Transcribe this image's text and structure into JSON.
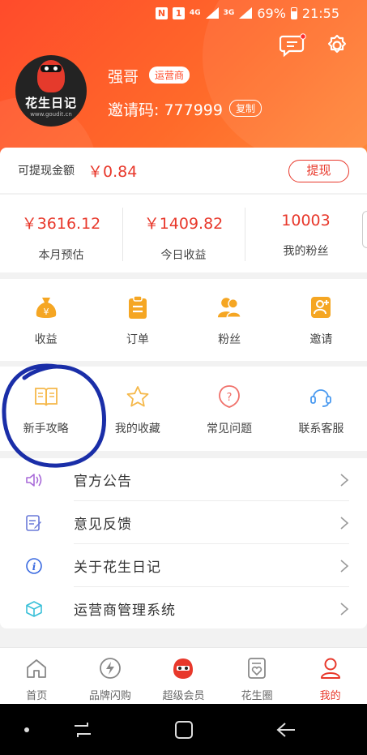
{
  "status_bar": {
    "net_4g": "4G",
    "net_3g": "3G",
    "battery": "69%",
    "time": "21:55"
  },
  "header": {
    "avatar_text": "花生日记",
    "avatar_url": "www.goudit.cn",
    "username": "强哥",
    "role_badge": "运营商",
    "invite_label": "邀请码: 777999",
    "copy_label": "复制"
  },
  "withdraw": {
    "label": "可提现金额",
    "amount": "￥0.84",
    "button": "提现"
  },
  "stats": [
    {
      "value": "￥3616.12",
      "label": "本月预估"
    },
    {
      "value": "￥1409.82",
      "label": "今日收益"
    },
    {
      "value": "10003",
      "label": "我的粉丝"
    }
  ],
  "quick_grid": [
    {
      "label": "收益",
      "icon": "money-bag-icon"
    },
    {
      "label": "订单",
      "icon": "clipboard-icon"
    },
    {
      "label": "粉丝",
      "icon": "people-icon"
    },
    {
      "label": "邀请",
      "icon": "invite-icon"
    }
  ],
  "tools_grid": [
    {
      "label": "新手攻略",
      "icon": "book-icon"
    },
    {
      "label": "我的收藏",
      "icon": "star-icon"
    },
    {
      "label": "常见问题",
      "icon": "question-icon"
    },
    {
      "label": "联系客服",
      "icon": "headset-icon"
    }
  ],
  "menu": [
    {
      "label": "官方公告",
      "icon": "speaker-icon"
    },
    {
      "label": "意见反馈",
      "icon": "feedback-icon"
    },
    {
      "label": "关于花生日记",
      "icon": "info-icon"
    },
    {
      "label": "运营商管理系统",
      "icon": "cube-icon"
    }
  ],
  "tabbar": [
    {
      "label": "首页",
      "icon": "home-icon"
    },
    {
      "label": "品牌闪购",
      "icon": "flash-icon"
    },
    {
      "label": "超级会员",
      "icon": "mascot-icon"
    },
    {
      "label": "花生圈",
      "icon": "heart-card-icon"
    },
    {
      "label": "我的",
      "icon": "user-icon",
      "active": true
    }
  ],
  "colors": {
    "brand_red": "#e8382b",
    "header_orange": "#ff5a2a",
    "annotation_blue": "#1a2ea8"
  }
}
